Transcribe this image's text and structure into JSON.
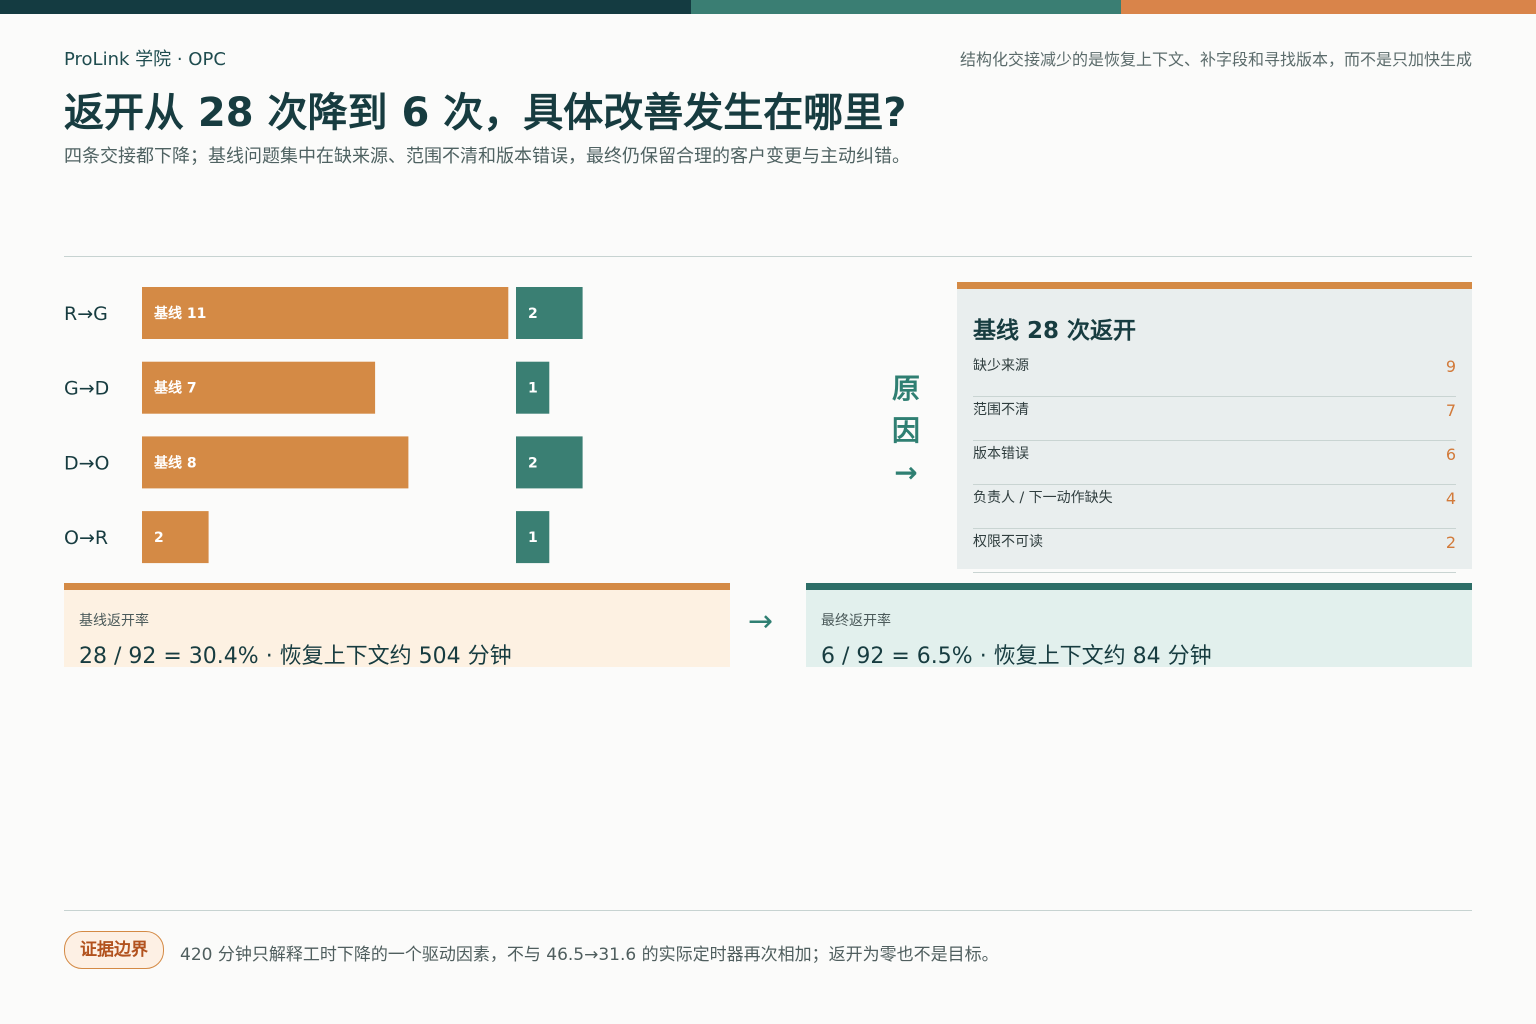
{
  "header": {
    "brand": "ProLink 学院 · OPC",
    "tagline": "结构化交接减少的是恢复上下文、补字段和寻找版本，而不是只加快生成",
    "title": "返开从 28 次降到 6 次，具体改善发生在哪里?",
    "subtitle": "四条交接都下降；基线问题集中在缺来源、范围不清和版本错误，最终仍保留合理的客户变更与主动纠错。"
  },
  "colors": {
    "top_bar": [
      "#143b41",
      "#3a7e73",
      "#d9844a"
    ],
    "baseline": "#d48a45",
    "final": "#3a7f73",
    "accent": "#d27a3a"
  },
  "chart_data": {
    "type": "bar",
    "categories": [
      "R→G",
      "G→D",
      "D→O",
      "O→R"
    ],
    "series": [
      {
        "name": "基线",
        "values": [
          11,
          7,
          8,
          2
        ]
      },
      {
        "values": [
          2,
          1,
          2,
          1
        ]
      }
    ],
    "baseline_labels": [
      "基线 11",
      "基线 7",
      "基线 8",
      "2"
    ],
    "final_labels": [
      "2",
      "1",
      "2",
      "1"
    ]
  },
  "causes": {
    "arrow_text": [
      "原",
      "因",
      "→"
    ],
    "title": "基线 28 次返开",
    "items": [
      {
        "name": "缺少来源",
        "value": "9"
      },
      {
        "name": "范围不清",
        "value": "7"
      },
      {
        "name": "版本错误",
        "value": "6"
      },
      {
        "name": "负责人 / 下一动作缺失",
        "value": "4"
      },
      {
        "name": "权限不可读",
        "value": "2"
      }
    ]
  },
  "rates": {
    "baseline": {
      "label": "基线返开率",
      "value": "28 / 92 = 30.4% · 恢复上下文约 504 分钟"
    },
    "arrow": "→",
    "final": {
      "label": "最终返开率",
      "value": "6 / 92 = 6.5% · 恢复上下文约 84 分钟"
    }
  },
  "footer": {
    "badge": "证据边界",
    "note": "420 分钟只解释工时下降的一个驱动因素，不与 46.5→31.6 的实际定时器再次相加；返开为零也不是目标。"
  }
}
